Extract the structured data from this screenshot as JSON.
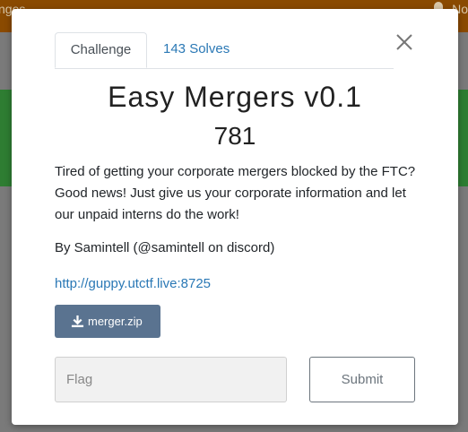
{
  "background": {
    "topbar_left_text": "nges",
    "topbar_right_text": "No"
  },
  "modal": {
    "tabs": [
      {
        "label": "Challenge",
        "active": true
      },
      {
        "label": "143 Solves",
        "active": false
      }
    ],
    "title": "Easy Mergers v0.1",
    "points": "781",
    "description": "Tired of getting your corporate mergers blocked by the FTC? Good news! Just give us your corporate information and let our unpaid interns do the work!",
    "author": "By Samintell (@samintell on discord)",
    "link_text": "http://guppy.utctf.live:8725",
    "file_button_label": "merger.zip",
    "flag_placeholder": "Flag",
    "submit_label": "Submit"
  },
  "colors": {
    "link": "#2a78b5",
    "download_button": "#5a7390"
  }
}
